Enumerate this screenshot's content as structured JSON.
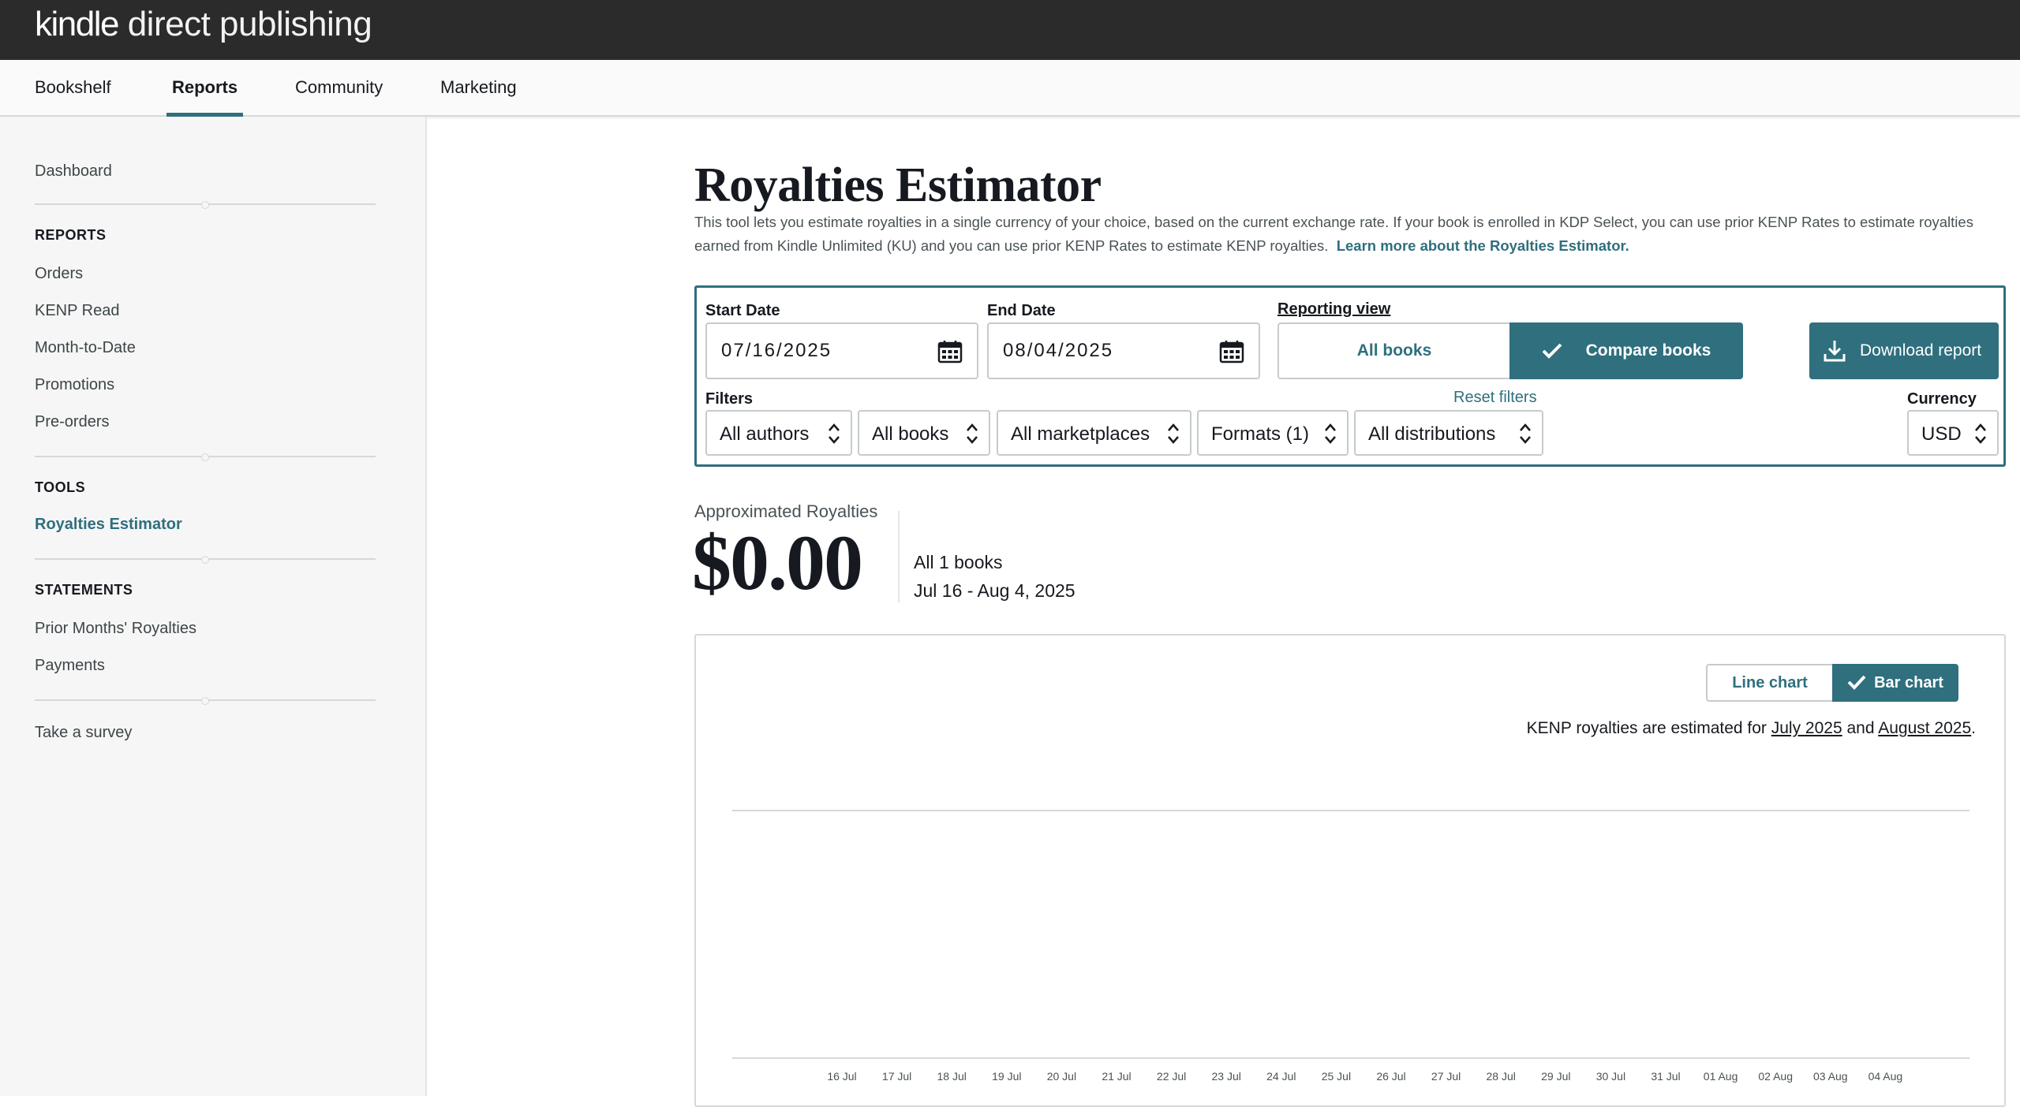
{
  "app": {
    "logo_kindle": "kindle",
    "logo_rest": " direct publishing"
  },
  "nav": {
    "items": [
      {
        "label": "Bookshelf",
        "active": false
      },
      {
        "label": "Reports",
        "active": true
      },
      {
        "label": "Community",
        "active": false
      },
      {
        "label": "Marketing",
        "active": false
      }
    ]
  },
  "sidebar": {
    "dashboard": "Dashboard",
    "reports_heading": "REPORTS",
    "reports_items": [
      "Orders",
      "KENP Read",
      "Month-to-Date",
      "Promotions",
      "Pre-orders"
    ],
    "tools_heading": "TOOLS",
    "tools_items": [
      "Royalties Estimator"
    ],
    "statements_heading": "STATEMENTS",
    "statements_items": [
      "Prior Months' Royalties",
      "Payments"
    ],
    "survey": "Take a survey"
  },
  "page": {
    "title": "Royalties Estimator",
    "intro": "This tool lets you estimate royalties in a single currency of your choice, based on the current exchange rate. If your book is enrolled in KDP Select, you can use prior KENP Rates to estimate royalties earned from Kindle Unlimited (KU) and you can use prior KENP Rates to estimate KENP royalties.",
    "learn_more": "Learn more about the Royalties Estimator."
  },
  "filters": {
    "start_label": "Start Date",
    "start_value": "07/16/2025",
    "end_label": "End Date",
    "end_value": "08/04/2025",
    "view_label": "Reporting view",
    "view_all": "All books",
    "view_compare": "Compare books",
    "download": "Download report",
    "filters_label": "Filters",
    "reset": "Reset filters",
    "authors": "All authors",
    "books": "All books",
    "marketplaces": "All marketplaces",
    "formats": "Formats (1)",
    "distributions": "All distributions",
    "currency_label": "Currency",
    "currency": "USD"
  },
  "summary": {
    "label": "Approximated Royalties",
    "amount": "$0.00",
    "books": "All 1 books",
    "range": "Jul 16 - Aug 4, 2025"
  },
  "chart": {
    "toggle_line": "Line chart",
    "toggle_bar": "Bar chart",
    "note_prefix": "KENP royalties are estimated for ",
    "note_month1": "July 2025",
    "note_and": " and ",
    "note_month2": "August 2025",
    "note_suffix": "."
  },
  "colors": {
    "accent": "#2f6f7e",
    "header": "#2b2b2b"
  },
  "chart_data": {
    "type": "bar",
    "categories": [
      "16 Jul",
      "17 Jul",
      "18 Jul",
      "19 Jul",
      "20 Jul",
      "21 Jul",
      "22 Jul",
      "23 Jul",
      "24 Jul",
      "25 Jul",
      "26 Jul",
      "27 Jul",
      "28 Jul",
      "29 Jul",
      "30 Jul",
      "31 Jul",
      "01 Aug",
      "02 Aug",
      "03 Aug",
      "04 Aug"
    ],
    "values": [
      0,
      0,
      0,
      0,
      0,
      0,
      0,
      0,
      0,
      0,
      0,
      0,
      0,
      0,
      0,
      0,
      0,
      0,
      0,
      0
    ],
    "ylim": [
      0,
      1
    ],
    "grid": true
  }
}
